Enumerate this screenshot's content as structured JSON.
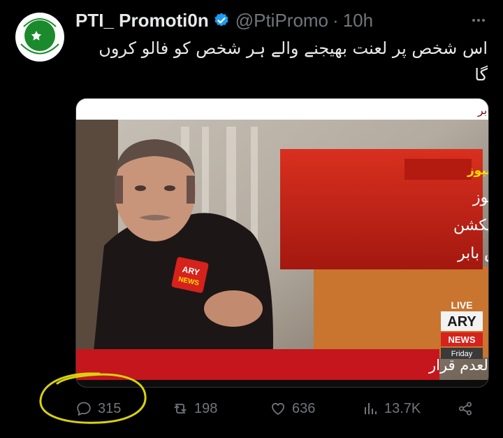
{
  "colors": {
    "background": "#000000",
    "text": "#e7e9ea",
    "muted": "#71767b",
    "verified_badge": "#1d9bf0",
    "news_red": "#c8221c",
    "annotation": "#d8d20e"
  },
  "account": {
    "name": "PTI_ Promoti0n",
    "handle": "@PtiPromo",
    "separator": "·",
    "time": "10h",
    "avatar_caption": "Pakistan Tehreek-e-Insaf"
  },
  "tweet": {
    "text": "اس شخص پر لعنت بھیجنے والے ہر شخص کو فالو کروں گا"
  },
  "media": {
    "ticker_top": "پی ٹی آئی رہنماؤں سے مشاورت کی جائے گی، اکبر ایس بابر",
    "breaking_label": "بریکنگ نیوز",
    "breaking_line1": "پی ٹی آئی ورکرز کنفیوز",
    "breaking_line2": "ہیں، ان کو ڈائریکشن",
    "breaking_line3": "دیں گے، اکبر ایس بابر",
    "ticker_bottom": "پی ٹی آئی انٹرا پارٹی الیکشن کالعدم قرار",
    "live_label": "LIVE",
    "channel_logo": "ARY",
    "channel_news": "NEWS",
    "day": "Friday",
    "mic_label": "ARY",
    "mic_sub": "NEWS"
  },
  "actions": {
    "replies": "315",
    "retweets": "198",
    "likes": "636",
    "views": "13.7K"
  },
  "icons": [
    "verified-badge-icon",
    "more-options-icon",
    "reply-icon",
    "retweet-icon",
    "like-icon",
    "views-icon",
    "share-icon"
  ]
}
